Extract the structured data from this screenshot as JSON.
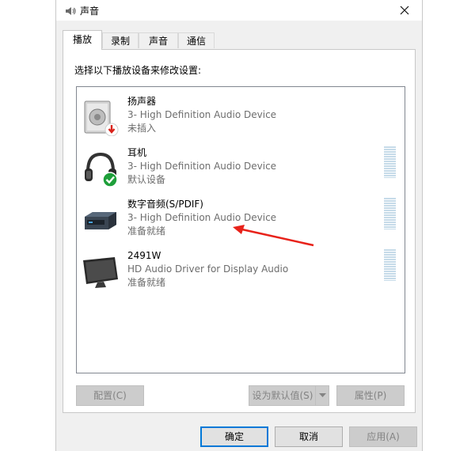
{
  "window": {
    "title": "声音",
    "close_glyph": "✕"
  },
  "tabs": [
    {
      "label": "播放",
      "active": true
    },
    {
      "label": "录制",
      "active": false
    },
    {
      "label": "声音",
      "active": false
    },
    {
      "label": "通信",
      "active": false
    }
  ],
  "panel": {
    "instruction": "选择以下播放设备来修改设置:"
  },
  "devices": [
    {
      "name": "扬声器",
      "description": "3- High Definition Audio Device",
      "status": "未插入",
      "icon": "speaker-icon",
      "badge": "unplugged-arrow"
    },
    {
      "name": "耳机",
      "description": "3- High Definition Audio Device",
      "status": "默认设备",
      "icon": "headphones-icon",
      "badge": "default-check"
    },
    {
      "name": "数字音频(S/PDIF)",
      "description": "3- High Definition Audio Device",
      "status": "准备就绪",
      "icon": "digital-audio-icon"
    },
    {
      "name": "2491W",
      "description": "HD Audio Driver for Display Audio",
      "status": "准备就绪",
      "icon": "monitor-icon"
    }
  ],
  "panel_buttons": {
    "configure": "配置(C)",
    "set_default": "设为默认值(S)",
    "properties": "属性(P)"
  },
  "dialog_buttons": {
    "ok": "确定",
    "cancel": "取消",
    "apply": "应用(A)"
  },
  "colors": {
    "accent": "#0078d7",
    "annotation_arrow": "#e8221a",
    "check_badge": "#1e9f3a",
    "unplugged_badge": "#d9231b"
  }
}
